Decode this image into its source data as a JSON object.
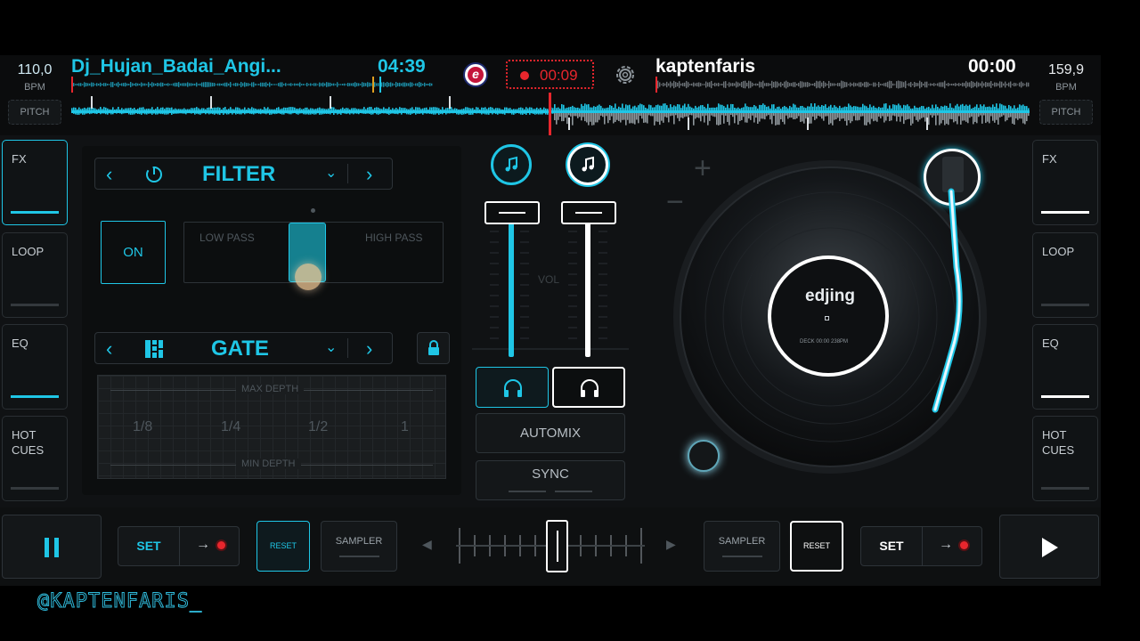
{
  "deck_left": {
    "bpm": "110,0",
    "bpm_unit": "BPM",
    "pitch_label": "PITCH",
    "track_title": "Dj_Hujan_Badai_Angi...",
    "time": "04:39",
    "color": "#1fc6e6"
  },
  "deck_right": {
    "bpm": "159,9",
    "bpm_unit": "BPM",
    "pitch_label": "PITCH",
    "track_title": "kaptenfaris",
    "time": "00:00",
    "color": "#ffffff"
  },
  "recorder": {
    "time": "00:09",
    "color": "#e8262d"
  },
  "left_side_tabs": [
    {
      "label": "FX"
    },
    {
      "label": "LOOP"
    },
    {
      "label": "EQ"
    },
    {
      "label": "HOT\nCUES"
    }
  ],
  "right_side_tabs": [
    {
      "label": "FX"
    },
    {
      "label": "LOOP"
    },
    {
      "label": "EQ"
    },
    {
      "label": "HOT\nCUES"
    }
  ],
  "fx_panel": {
    "effect1": {
      "name": "FILTER",
      "on_label": "ON",
      "low_label": "LOW PASS",
      "high_label": "HIGH PASS"
    },
    "effect2": {
      "name": "GATE",
      "max_label": "MAX DEPTH",
      "min_label": "MIN DEPTH",
      "divisions": [
        "1/8",
        "1/4",
        "1/2",
        "1"
      ]
    }
  },
  "mixer": {
    "vol_label": "VOL",
    "automix_label": "AUTOMIX",
    "sync_label": "SYNC",
    "left_volume": 1.0,
    "right_volume": 1.0
  },
  "turntable": {
    "label_brand": "edjing",
    "label_small": "DECK 00:00 238PM",
    "plus": "+",
    "minus": "−"
  },
  "bottom_bar": {
    "set_label": "SET",
    "reset_label": "RESET",
    "sampler_label": "SAMPLER",
    "crossfader_position": 0.5
  },
  "watermark": "@KAPTENFARIS_",
  "icons": {
    "app_logo": "edjing-e-icon",
    "settings": "gear-icon",
    "headphones": "headphones-icon",
    "music_note": "music-note-icon",
    "lock": "lock-icon",
    "pause": "pause-icon",
    "play": "play-icon"
  }
}
